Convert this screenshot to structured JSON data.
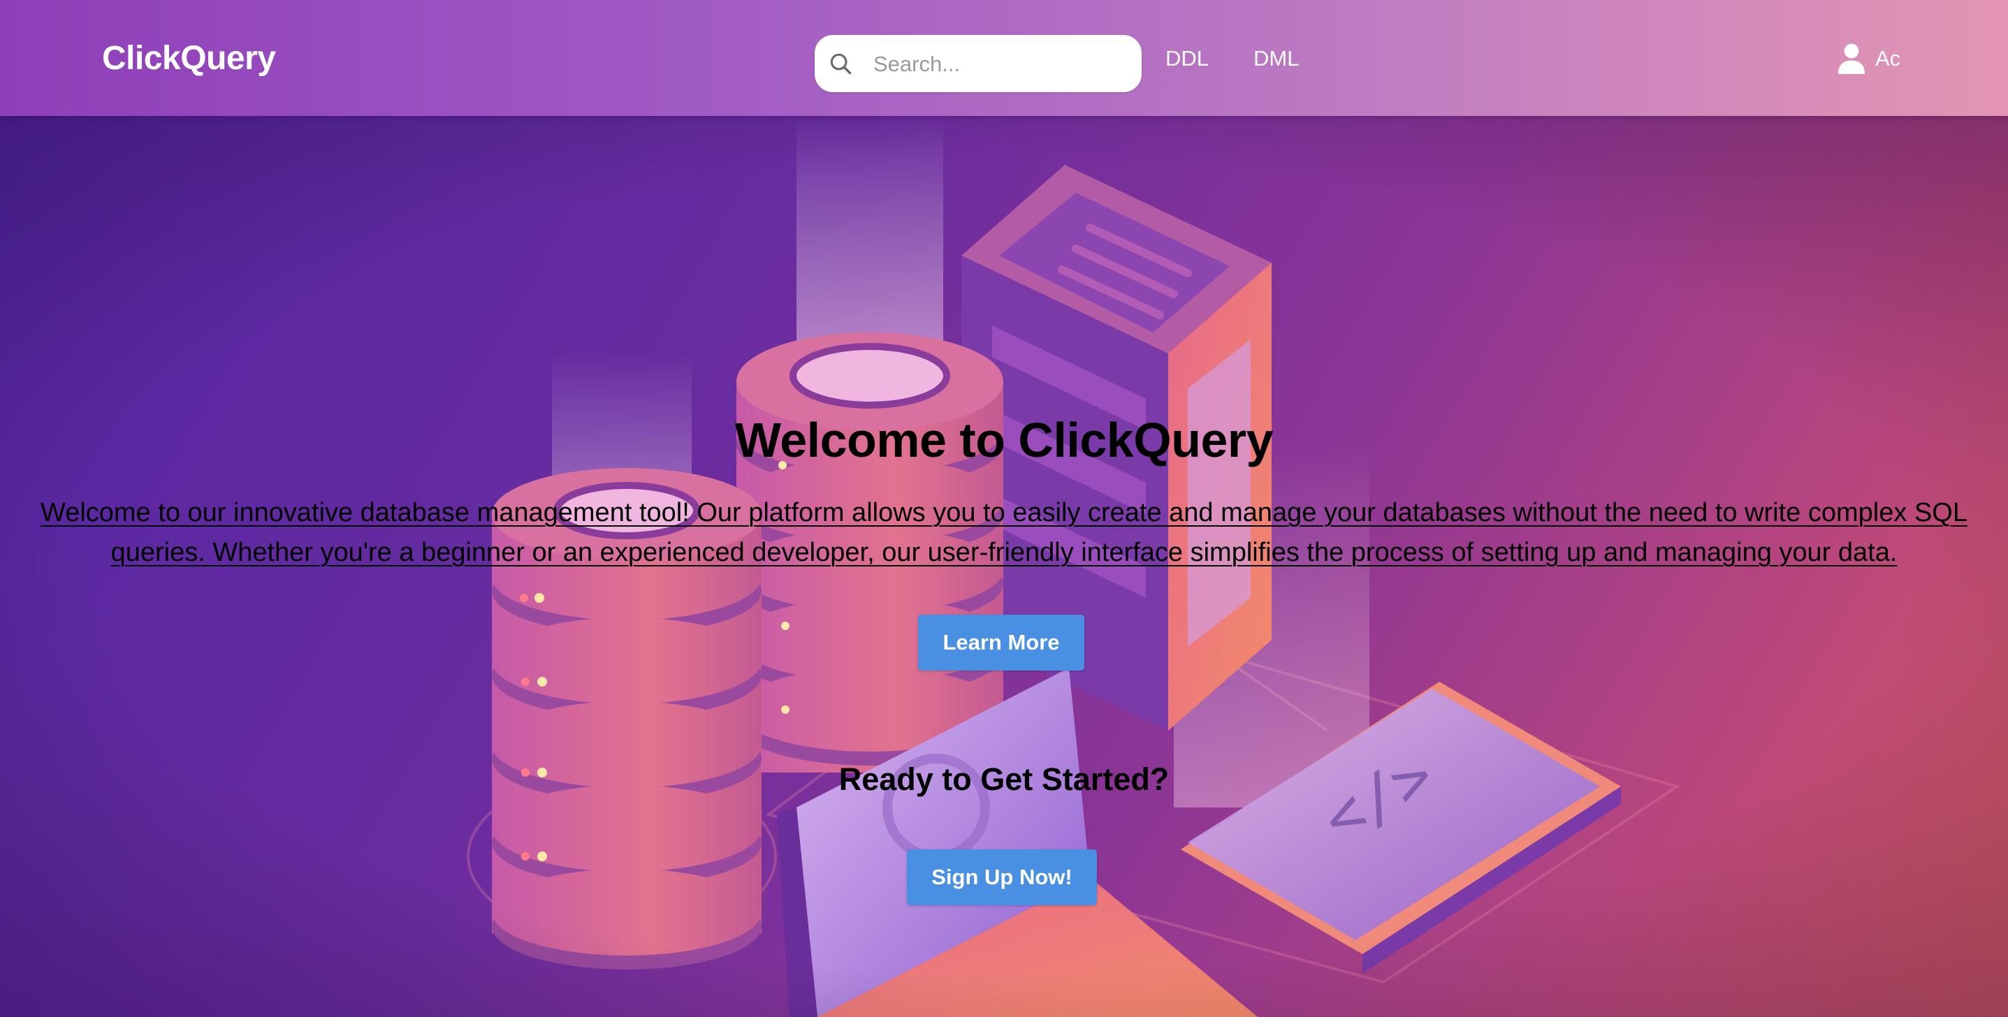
{
  "navbar": {
    "brand": "ClickQuery",
    "search": {
      "placeholder": "Search...",
      "value": ""
    },
    "links": [
      {
        "label": "DDL"
      },
      {
        "label": "DML"
      }
    ],
    "account": {
      "label": "Ac",
      "icon": "user-icon"
    }
  },
  "hero": {
    "title": "Welcome to ClickQuery",
    "description": "Welcome to our innovative database management tool! Our platform allows you to easily create and manage your databases without the need to write complex SQL queries. Whether you're a beginner or an experienced developer, our user-friendly interface simplifies the process of setting up and managing your data.",
    "learn_more_label": "Learn More",
    "cta_title": "Ready to Get Started?",
    "signup_label": "Sign Up Now!"
  },
  "colors": {
    "nav_gradient_start": "#8e3fb8",
    "nav_gradient_end": "#e495b3",
    "button": "#4a90e2",
    "hero_purple": "#5326a3",
    "hero_coral": "#d55a62"
  }
}
